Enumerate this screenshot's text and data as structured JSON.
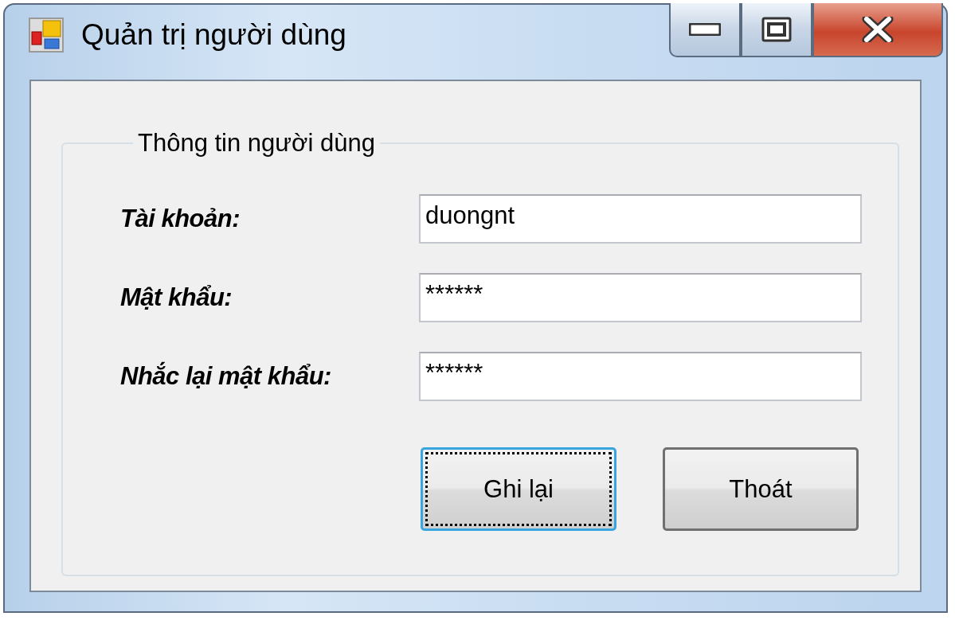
{
  "window": {
    "title": "Quản trị người dùng",
    "controls": [
      {
        "kind": "minimize"
      },
      {
        "kind": "maximize"
      },
      {
        "kind": "close"
      }
    ]
  },
  "group": {
    "title": "Thông tin người dùng",
    "fields": [
      {
        "label": "Tài khoản:",
        "value": "duongnt"
      },
      {
        "label": "Mật khẩu:",
        "value": "******"
      },
      {
        "label": "Nhắc lại mật khẩu:",
        "value": "******"
      }
    ]
  },
  "buttons": [
    {
      "label": "Ghi lại",
      "focused": true
    },
    {
      "label": "Thoát",
      "focused": false
    }
  ]
}
